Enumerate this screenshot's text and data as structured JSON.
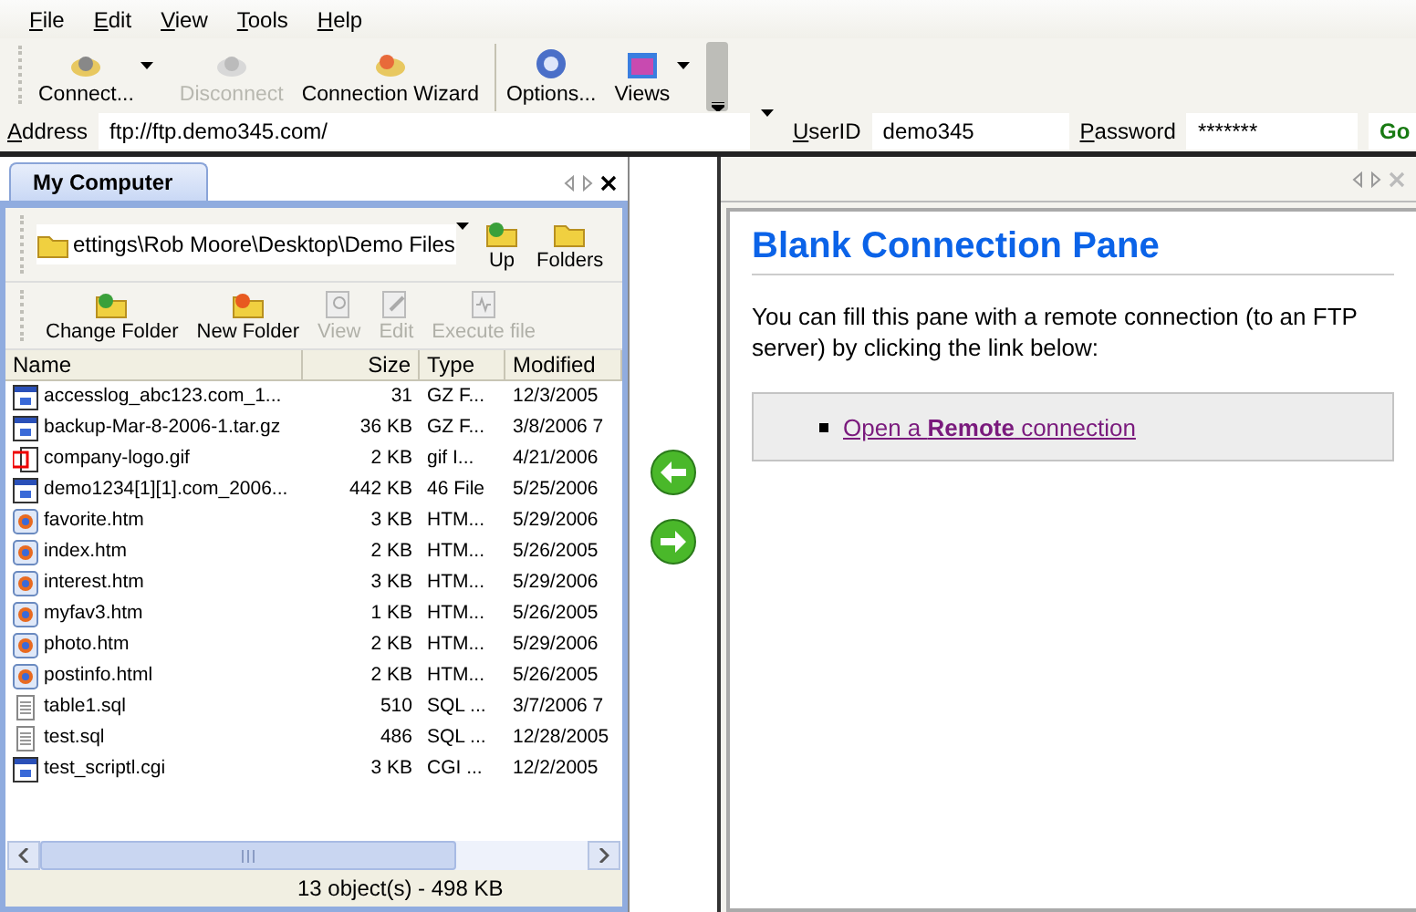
{
  "menu": [
    "File",
    "Edit",
    "View",
    "Tools",
    "Help"
  ],
  "toolbar": [
    {
      "label": "Connect...",
      "disabled": false,
      "dropdown": true,
      "group_start": false
    },
    {
      "label": "Disconnect",
      "disabled": true,
      "dropdown": false,
      "group_start": false
    },
    {
      "label": "Connection Wizard",
      "disabled": false,
      "dropdown": false,
      "group_start": false
    },
    {
      "label": "Options...",
      "disabled": false,
      "dropdown": false,
      "group_start": true
    },
    {
      "label": "Views",
      "disabled": false,
      "dropdown": true,
      "group_start": false
    }
  ],
  "address_bar": {
    "address_label": "Address",
    "address": "ftp://ftp.demo345.com/",
    "userid_label": "UserID",
    "userid": "demo345",
    "password_label": "Password",
    "password": "*******",
    "go": "Go"
  },
  "left_pane": {
    "tab": "My Computer",
    "path": "ettings\\Rob Moore\\Desktop\\Demo Files",
    "path_buttons": [
      "Up",
      "Folders"
    ],
    "file_toolbar": [
      {
        "label": "Change Folder",
        "disabled": false
      },
      {
        "label": "New Folder",
        "disabled": false
      },
      {
        "label": "View",
        "disabled": true
      },
      {
        "label": "Edit",
        "disabled": true
      },
      {
        "label": "Execute file",
        "disabled": true
      }
    ],
    "columns": [
      "Name",
      "Size",
      "Type",
      "Modified"
    ],
    "rows": [
      {
        "kind": "window",
        "name": "accesslog_abc123.com_1...",
        "size": "31",
        "type": "GZ F...",
        "modified": "12/3/2005"
      },
      {
        "kind": "window",
        "name": "backup-Mar-8-2006-1.tar.gz",
        "size": "36 KB",
        "type": "GZ F...",
        "modified": "3/8/2006 7"
      },
      {
        "kind": "image",
        "name": "company-logo.gif",
        "size": "2 KB",
        "type": "gif I...",
        "modified": "4/21/2006"
      },
      {
        "kind": "window",
        "name": "demo1234[1][1].com_2006...",
        "size": "442 KB",
        "type": "46 File",
        "modified": "5/25/2006"
      },
      {
        "kind": "web",
        "name": "favorite.htm",
        "size": "3 KB",
        "type": "HTM...",
        "modified": "5/29/2006"
      },
      {
        "kind": "web",
        "name": "index.htm",
        "size": "2 KB",
        "type": "HTM...",
        "modified": "5/26/2005"
      },
      {
        "kind": "web",
        "name": "interest.htm",
        "size": "3 KB",
        "type": "HTM...",
        "modified": "5/29/2006"
      },
      {
        "kind": "web",
        "name": "myfav3.htm",
        "size": "1 KB",
        "type": "HTM...",
        "modified": "5/26/2005"
      },
      {
        "kind": "web",
        "name": "photo.htm",
        "size": "2 KB",
        "type": "HTM...",
        "modified": "5/29/2006"
      },
      {
        "kind": "web",
        "name": "postinfo.html",
        "size": "2 KB",
        "type": "HTM...",
        "modified": "5/26/2005"
      },
      {
        "kind": "text",
        "name": "table1.sql",
        "size": "510",
        "type": "SQL ...",
        "modified": "3/7/2006 7"
      },
      {
        "kind": "text",
        "name": "test.sql",
        "size": "486",
        "type": "SQL ...",
        "modified": "12/28/2005"
      },
      {
        "kind": "window",
        "name": "test_scriptl.cgi",
        "size": "3 KB",
        "type": "CGI ...",
        "modified": "12/2/2005"
      }
    ],
    "status": "13 object(s) - 498 KB"
  },
  "right_pane": {
    "title": "Blank Connection Pane",
    "text": "You can fill this pane with a remote connection (to an FTP server) by clicking the link below:",
    "link": "Open a **Remote** connection"
  }
}
